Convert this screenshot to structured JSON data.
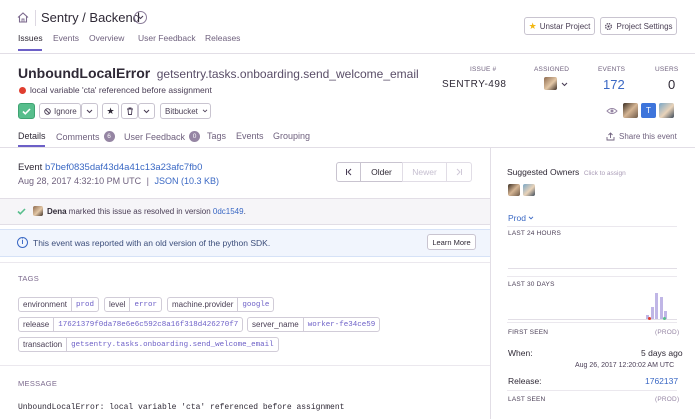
{
  "header": {
    "breadcrumb": "Sentry / Backend",
    "nav": [
      "Issues",
      "Events",
      "Overview",
      "User Feedback",
      "Releases"
    ],
    "unstar_label": "Unstar Project",
    "settings_label": "Project Settings"
  },
  "issue": {
    "title": "UnboundLocalError",
    "culprit": "getsentry.tasks.onboarding.send_welcome_email",
    "message": "local variable 'cta' referenced before assignment",
    "ignore_label": "Ignore",
    "bitbucket_label": "Bitbucket",
    "stats": {
      "issue_label": "ISSUE #",
      "issue_value": "SENTRY-498",
      "assigned_label": "ASSIGNED",
      "events_label": "EVENTS",
      "events_value": "172",
      "users_label": "USERS",
      "users_value": "0"
    },
    "avatar_t": "T"
  },
  "tabs": {
    "details": "Details",
    "comments": "Comments",
    "comments_count": "6",
    "user_feedback": "User Feedback",
    "user_feedback_count": "0",
    "tags": "Tags",
    "events": "Events",
    "grouping": "Grouping",
    "share": "Share this event"
  },
  "event": {
    "label": "Event",
    "id": "b7bef0835daf43d4a41c13a23afc7fb0",
    "date": "Aug 28, 2017 4:32:10 PM UTC",
    "json_link": "JSON (10.3 KB)",
    "older": "Older",
    "newer": "Newer"
  },
  "resolved": {
    "user": "Dena",
    "text": "marked this issue as resolved in version",
    "version": "0dc1549",
    "end": "."
  },
  "sdk_notice": {
    "text": "This event was reported with an old version of the python SDK.",
    "button": "Learn More"
  },
  "tags_section": {
    "title": "TAGS",
    "items": [
      {
        "key": "environment",
        "value": "prod"
      },
      {
        "key": "level",
        "value": "error"
      },
      {
        "key": "machine.provider",
        "value": "google"
      },
      {
        "key": "release",
        "value": "17621379f0da78e6e6c592c8a16f318d426270f7"
      },
      {
        "key": "server_name",
        "value": "worker-fe34ce59"
      },
      {
        "key": "transaction",
        "value": "getsentry.tasks.onboarding.send_welcome_email"
      }
    ]
  },
  "message_section": {
    "title": "MESSAGE",
    "body": "UnboundLocalError: local variable 'cta' referenced before assignment"
  },
  "sidebar": {
    "suggested_owners": "Suggested Owners",
    "click_to_assign": "Click to assign",
    "env": "Prod",
    "last_24h": "LAST 24 HOURS",
    "last_30d": "LAST 30 DAYS",
    "spark_30d": [
      0.15,
      0.45,
      1.0,
      0.85,
      0.3
    ],
    "first_seen": "FIRST SEEN",
    "first_seen_env": "(PROD)",
    "when_label": "When:",
    "when_value": "5 days ago",
    "when_exact": "Aug 26, 2017 12:20:02 AM UTC",
    "release_label": "Release:",
    "release_value": "1762137",
    "last_seen": "LAST SEEN",
    "last_seen_env": "(PROD)"
  },
  "colors": {
    "accent": "#6c5fc7",
    "link": "#3a68c4",
    "resolved_green": "#57be8c",
    "error_red": "#e03e2f",
    "avatar_blue": "#3d74db"
  }
}
